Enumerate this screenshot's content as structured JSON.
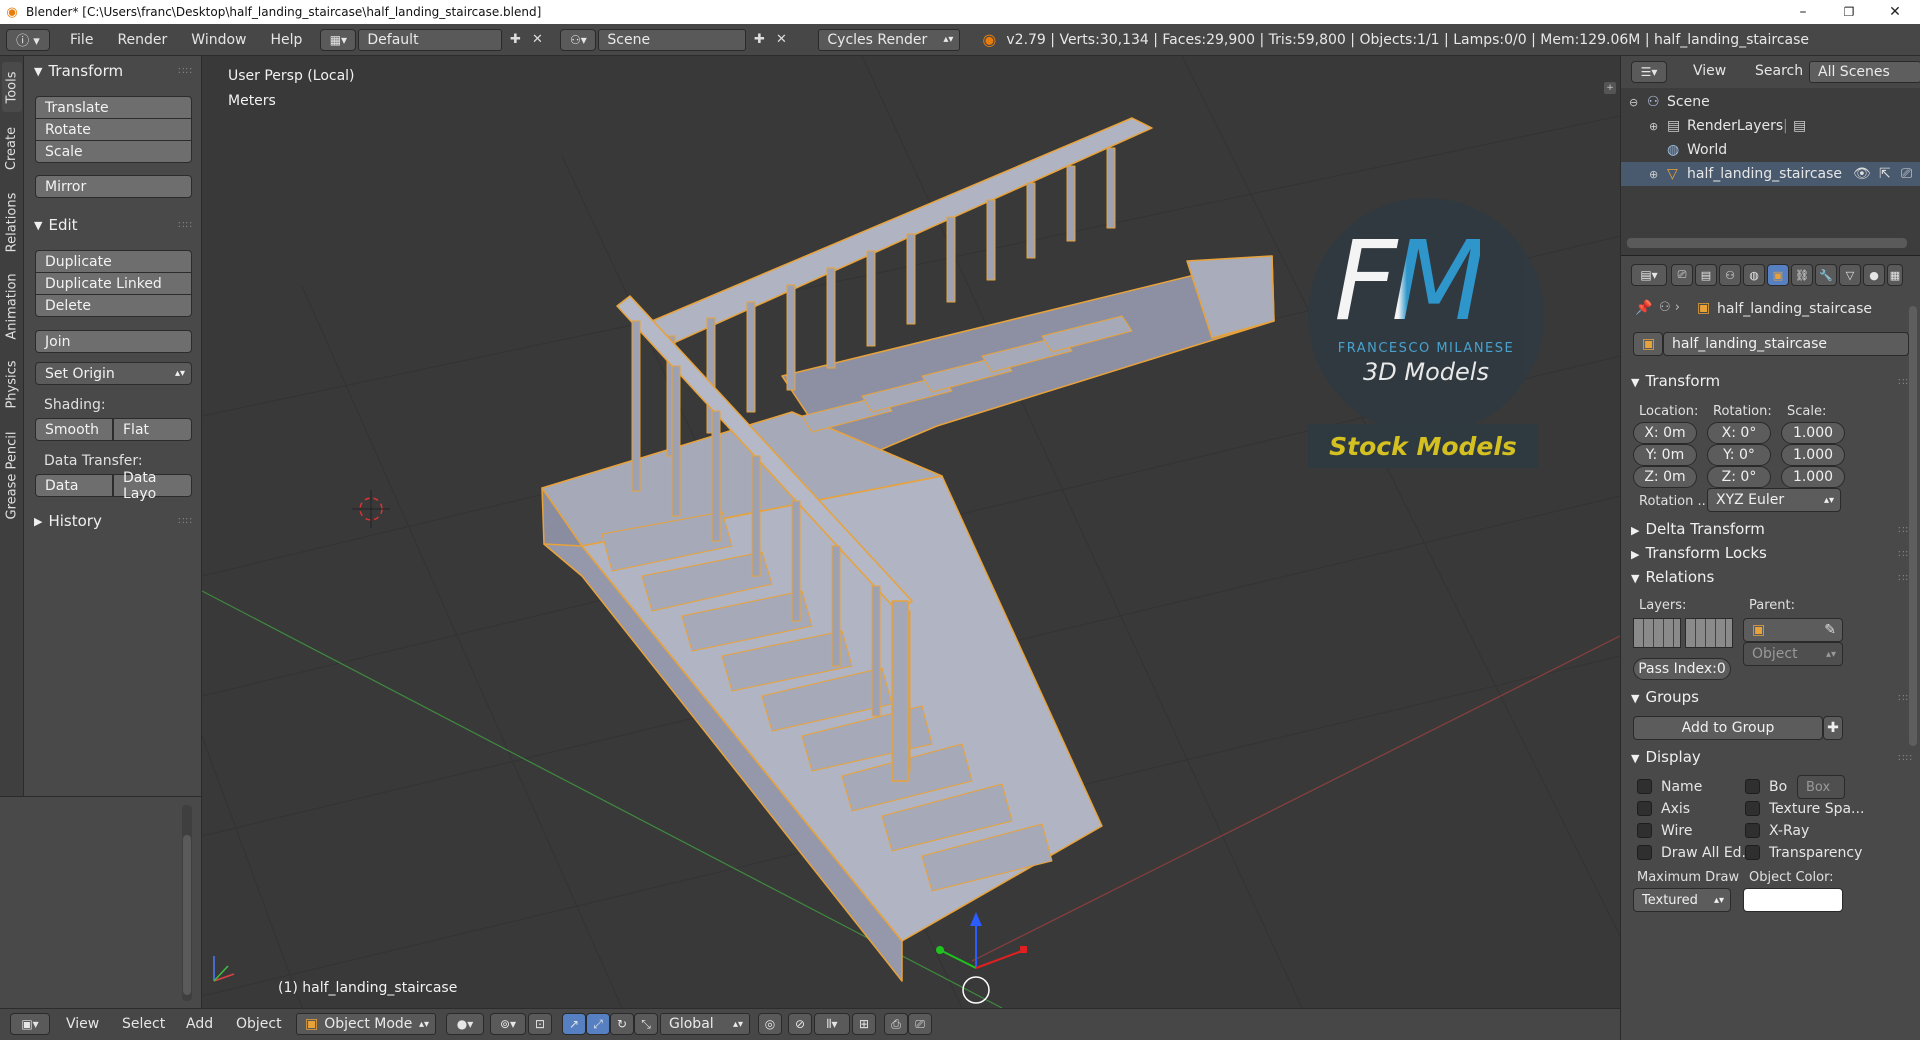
{
  "window": {
    "title": "Blender* [C:\\Users\\franc\\Desktop\\half_landing_staircase\\half_landing_staircase.blend]",
    "minimize": "–",
    "maximize": "❐",
    "close": "✕"
  },
  "menus": [
    "File",
    "Render",
    "Window",
    "Help"
  ],
  "layout": {
    "value": "Default"
  },
  "scene": {
    "value": "Scene"
  },
  "render_engine": "Cycles Render",
  "stats": "v2.79 | Verts:30,134 | Faces:29,900 | Tris:59,800 | Objects:1/1 | Lamps:0/0 | Mem:129.06M | half_landing_staircase",
  "left_tabs": [
    "Tools",
    "Create",
    "Relations",
    "Animation",
    "Physics",
    "Grease Pencil"
  ],
  "toolshelf": {
    "transform_header": "Transform",
    "translate": "Translate",
    "rotate": "Rotate",
    "scale": "Scale",
    "mirror": "Mirror",
    "edit_header": "Edit",
    "duplicate": "Duplicate",
    "duplicate_linked": "Duplicate Linked",
    "delete": "Delete",
    "join": "Join",
    "set_origin": "Set Origin",
    "shading_label": "Shading:",
    "smooth": "Smooth",
    "flat": "Flat",
    "data_transfer_label": "Data Transfer:",
    "data": "Data",
    "data_layout": "Data Layo",
    "history_header": "History"
  },
  "viewport": {
    "view_name": "User Persp (Local)",
    "units": "Meters",
    "object_label": "(1) half_landing_staircase",
    "logo": {
      "initials": "FM",
      "name": "FRANCESCO MILANESE",
      "subtitle": "3D Models",
      "banner": "Stock Models"
    },
    "colors": {
      "bg": "#393939",
      "stair": "#a6a9b7",
      "stair_dark": "#8a8da0",
      "outline": "#e8a23a",
      "grid": "#333333"
    }
  },
  "bottombar": {
    "view": "View",
    "select": "Select",
    "add": "Add",
    "object": "Object",
    "mode": "Object Mode",
    "orientation": "Global"
  },
  "outliner": {
    "view": "View",
    "search": "Search",
    "filter": "All Scenes",
    "items": [
      "Scene",
      "RenderLayers",
      "World",
      "half_landing_staircase"
    ]
  },
  "properties": {
    "breadcrumb": "half_landing_staircase",
    "object_name": "half_landing_staircase",
    "transform_header": "Transform",
    "location_label": "Location:",
    "rotation_label": "Rotation:",
    "scale_label": "Scale:",
    "location": [
      "X: 0m",
      "Y: 0m",
      "Z: 0m"
    ],
    "rotation": [
      "X:   0°",
      "Y:   0°",
      "Z:   0°"
    ],
    "scale": [
      "1.000",
      "1.000",
      "1.000"
    ],
    "rotation_mode_label": "Rotation ...",
    "rotation_mode": "XYZ Euler",
    "delta_transform": "Delta Transform",
    "transform_locks": "Transform Locks",
    "relations_header": "Relations",
    "layers_label": "Layers:",
    "parent_label": "Parent:",
    "parent_type": "Object",
    "pass_index": "Pass Index:0",
    "groups_header": "Groups",
    "add_to_group": "Add to Group",
    "display_header": "Display",
    "display_left": [
      "Name",
      "Axis",
      "Wire",
      "Draw All Ed..."
    ],
    "display_right": [
      "Bo",
      "Texture Spa...",
      "X-Ray",
      "Transparency"
    ],
    "bounds_type": "Box",
    "max_draw_label": "Maximum Draw",
    "object_color_label": "Object Color:",
    "max_draw_value": "Textured"
  }
}
